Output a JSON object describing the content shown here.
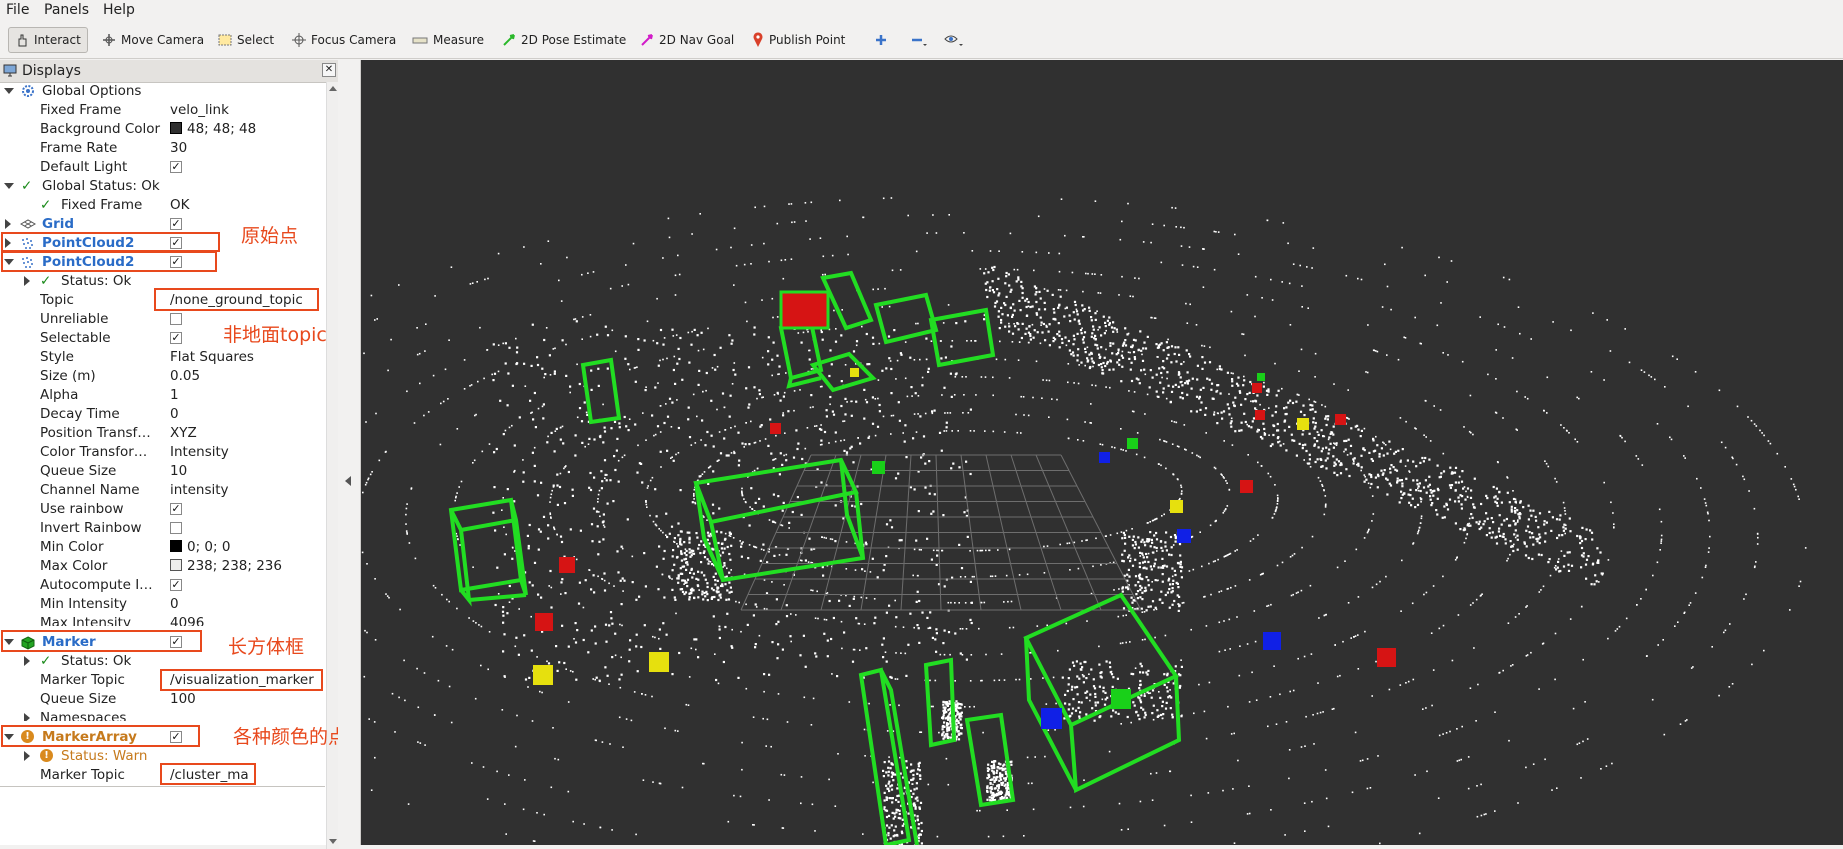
{
  "menubar": {
    "file": "File",
    "panels": "Panels",
    "help": "Help"
  },
  "toolbar": {
    "interact": "Interact",
    "move_camera": "Move Camera",
    "select": "Select",
    "focus_camera": "Focus Camera",
    "measure": "Measure",
    "pose_estimate": "2D Pose Estimate",
    "nav_goal": "2D Nav Goal",
    "publish_point": "Publish Point"
  },
  "displays": {
    "title": "Displays",
    "global_options": "Global Options",
    "fixed_frame_label": "Fixed Frame",
    "fixed_frame_value": "velo_link",
    "bg_color_label": "Background Color",
    "bg_color_value": "48; 48; 48",
    "frame_rate_label": "Frame Rate",
    "frame_rate_value": "30",
    "default_light_label": "Default Light",
    "global_status": "Global Status: Ok",
    "gs_fixed_frame_label": "Fixed Frame",
    "gs_fixed_frame_value": "OK",
    "grid": "Grid",
    "pc1": "PointCloud2",
    "pc2": "PointCloud2",
    "pc2_status": "Status: Ok",
    "topic_label": "Topic",
    "topic_value": "/none_ground_topic",
    "unreliable_label": "Unreliable",
    "selectable_label": "Selectable",
    "style_label": "Style",
    "style_value": "Flat Squares",
    "size_label": "Size (m)",
    "size_value": "0.05",
    "alpha_label": "Alpha",
    "alpha_value": "1",
    "decay_label": "Decay Time",
    "decay_value": "0",
    "pos_tf_label": "Position Transf…",
    "pos_tf_value": "XYZ",
    "color_tf_label": "Color Transfor…",
    "color_tf_value": "Intensity",
    "queue_label": "Queue Size",
    "queue_value": "10",
    "channel_label": "Channel Name",
    "channel_value": "intensity",
    "rainbow_label": "Use rainbow",
    "invert_label": "Invert Rainbow",
    "min_color_label": "Min Color",
    "min_color_value": "0; 0; 0",
    "max_color_label": "Max Color",
    "max_color_value": "238; 238; 236",
    "autocompute_label": "Autocompute I…",
    "min_int_label": "Min Intensity",
    "min_int_value": "0",
    "max_int_label": "Max Intensity",
    "max_int_value": "4096",
    "marker": "Marker",
    "marker_status": "Status: Ok",
    "marker_topic_label": "Marker Topic",
    "marker_topic_value": "/visualization_marker",
    "marker_queue_label": "Queue Size",
    "marker_queue_value": "100",
    "namespaces_label": "Namespaces",
    "markerarray": "MarkerArray",
    "ma_status": "Status: Warn",
    "ma_topic_label": "Marker Topic",
    "ma_topic_value": "/cluster_ma"
  },
  "annotations": {
    "raw_points": "原始点",
    "non_ground": "非地面topic",
    "boxes": "长方体框",
    "colored_points": "各种颜色的点"
  },
  "colors": {
    "background": "#303030",
    "box_green": "#22dd22",
    "highlight": "#e8491d",
    "link_blue": "#2a6cc7",
    "warn_orange": "#c67a1c"
  }
}
